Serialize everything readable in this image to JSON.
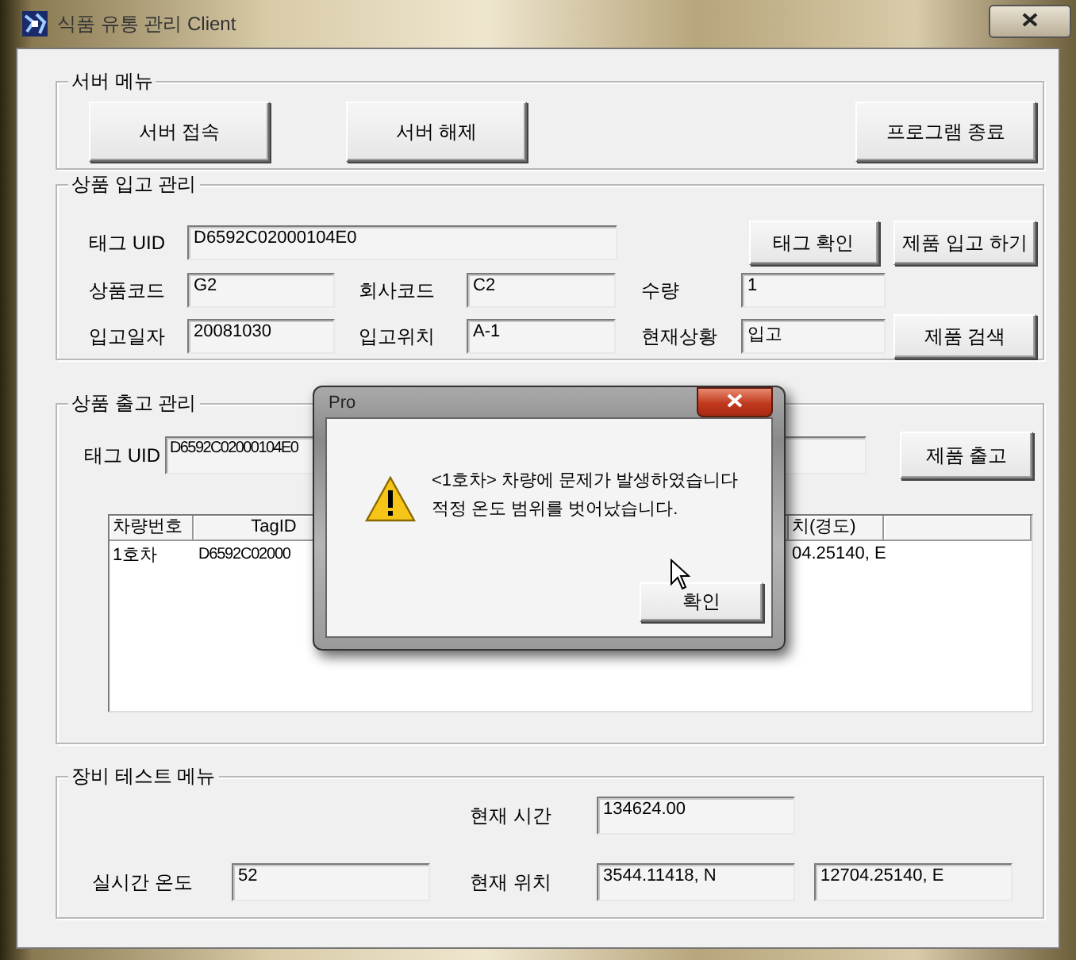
{
  "window": {
    "title": "식품 유통 관리 Client"
  },
  "server_menu": {
    "title": "서버 메뉴",
    "buttons": [
      "서버 접속",
      "서버 해제",
      "프로그램 종료"
    ]
  },
  "inbound": {
    "title": "상품 입고 관리",
    "tag_uid": {
      "label": "태그 UID",
      "value": "D6592C02000104E0"
    },
    "product_code": {
      "label": "상품코드",
      "value": "G2"
    },
    "company_code": {
      "label": "회사코드",
      "value": "C2"
    },
    "quantity": {
      "label": "수량",
      "value": "1"
    },
    "date": {
      "label": "입고일자",
      "value": "20081030"
    },
    "location": {
      "label": "입고위치",
      "value": "A-1"
    },
    "status": {
      "label": "현재상황",
      "value": "입고"
    },
    "buttons": {
      "tag_check": "태그 확인",
      "stock_in": "제품 입고 하기",
      "search": "제품 검색"
    }
  },
  "outbound": {
    "title": "상품 출고 관리",
    "tag_uid": {
      "label": "태그 UID",
      "value": "D6592C02000104E0"
    },
    "button": "제품 출고",
    "table": {
      "columns": [
        "차량번호",
        "TagID",
        "치(경도)"
      ],
      "rows": [
        [
          "1호차",
          "D6592C02000",
          "04.25140, E"
        ]
      ]
    }
  },
  "equipment": {
    "title": "장비 테스트 메뉴",
    "time": {
      "label": "현재 시간",
      "value": "134624.00"
    },
    "temperature": {
      "label": "실시간 온도",
      "value": "52"
    },
    "position": {
      "label": "현재 위치",
      "latitude": "3544.11418, N",
      "longitude": "12704.25140, E"
    }
  },
  "dialog": {
    "title": "Pro",
    "message": [
      "<1호차> 차량에 문제가 발생하였습니다",
      "적정 온도 범위를 벗어났습니다."
    ],
    "button": "확인"
  }
}
